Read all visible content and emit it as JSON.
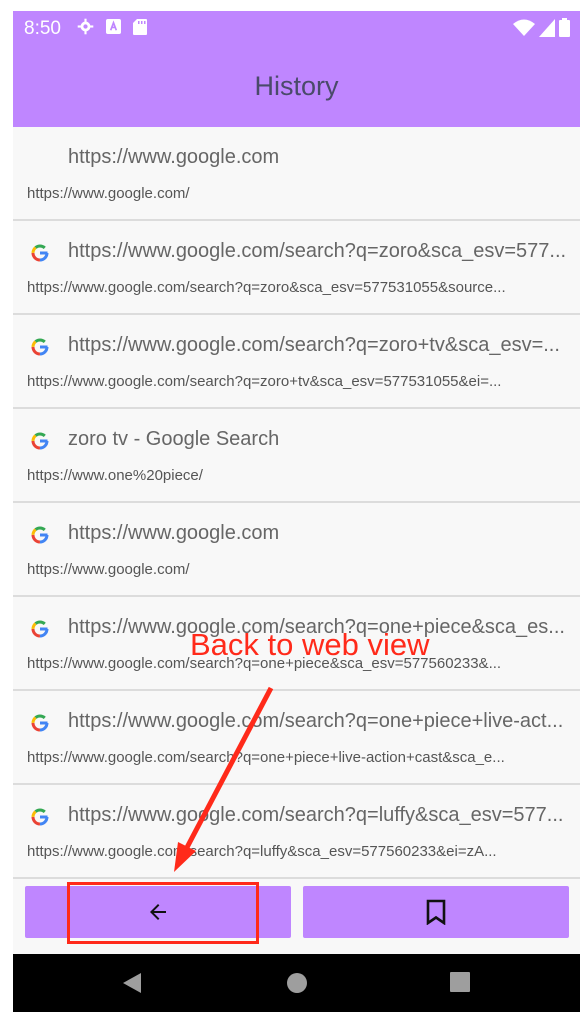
{
  "status_bar": {
    "time": "8:50",
    "left_icons": [
      "settings-icon",
      "a-icon",
      "sd-card-icon"
    ],
    "right_icons": [
      "wifi-icon",
      "signal-icon",
      "battery-icon"
    ]
  },
  "app_bar": {
    "title": "History"
  },
  "history": [
    {
      "title": "https://www.google.com",
      "url": "https://www.google.com/",
      "has_icon": false
    },
    {
      "title": "https://www.google.com/search?q=zoro&sca_esv=577...",
      "url": "https://www.google.com/search?q=zoro&sca_esv=577531055&source...",
      "has_icon": true
    },
    {
      "title": "https://www.google.com/search?q=zoro+tv&sca_esv=...",
      "url": "https://www.google.com/search?q=zoro+tv&sca_esv=577531055&ei=...",
      "has_icon": true
    },
    {
      "title": "zoro tv - Google Search",
      "url": "https://www.one%20piece/",
      "has_icon": true
    },
    {
      "title": "https://www.google.com",
      "url": "https://www.google.com/",
      "has_icon": true
    },
    {
      "title": "https://www.google.com/search?q=one+piece&sca_es...",
      "url": "https://www.google.com/search?q=one+piece&sca_esv=577560233&...",
      "has_icon": true
    },
    {
      "title": "https://www.google.com/search?q=one+piece+live-act...",
      "url": "https://www.google.com/search?q=one+piece+live-action+cast&sca_e...",
      "has_icon": true
    },
    {
      "title": "https://www.google.com/search?q=luffy&sca_esv=577...",
      "url": "https://www.google.com/search?q=luffy&sca_esv=577560233&ei=zA...",
      "has_icon": true
    }
  ],
  "bottom_buttons": {
    "back_icon": "back-arrow-icon",
    "bookmark_icon": "bookmark-icon"
  },
  "annotation": {
    "text": "Back to web view",
    "color": "#ff2a1a"
  },
  "colors": {
    "accent": "#bf86ff",
    "nav_bar": "#000000"
  }
}
